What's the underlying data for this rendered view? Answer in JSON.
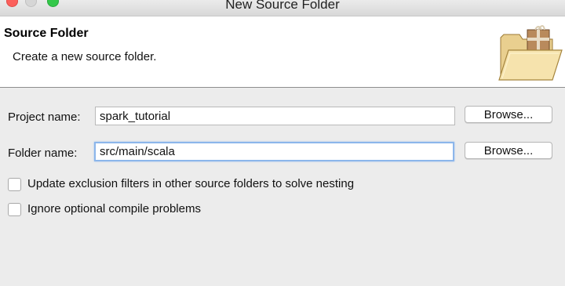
{
  "window": {
    "title": "New Source Folder"
  },
  "banner": {
    "title": "Source Folder",
    "description": "Create a new source folder.",
    "icon": "folder-package-icon"
  },
  "form": {
    "project_label": "Project name:",
    "project_value": "spark_tutorial",
    "project_browse": "Browse...",
    "folder_label": "Folder name:",
    "folder_value": "src/main/scala",
    "folder_browse": "Browse..."
  },
  "options": {
    "update_exclusion_label": "Update exclusion filters in other source folders to solve nesting",
    "update_exclusion_checked": false,
    "ignore_optional_label": "Ignore optional compile problems",
    "ignore_optional_checked": false
  },
  "colors": {
    "focus_ring": "#8cb6eb",
    "close": "#fc605c",
    "maximize": "#34c84a"
  }
}
